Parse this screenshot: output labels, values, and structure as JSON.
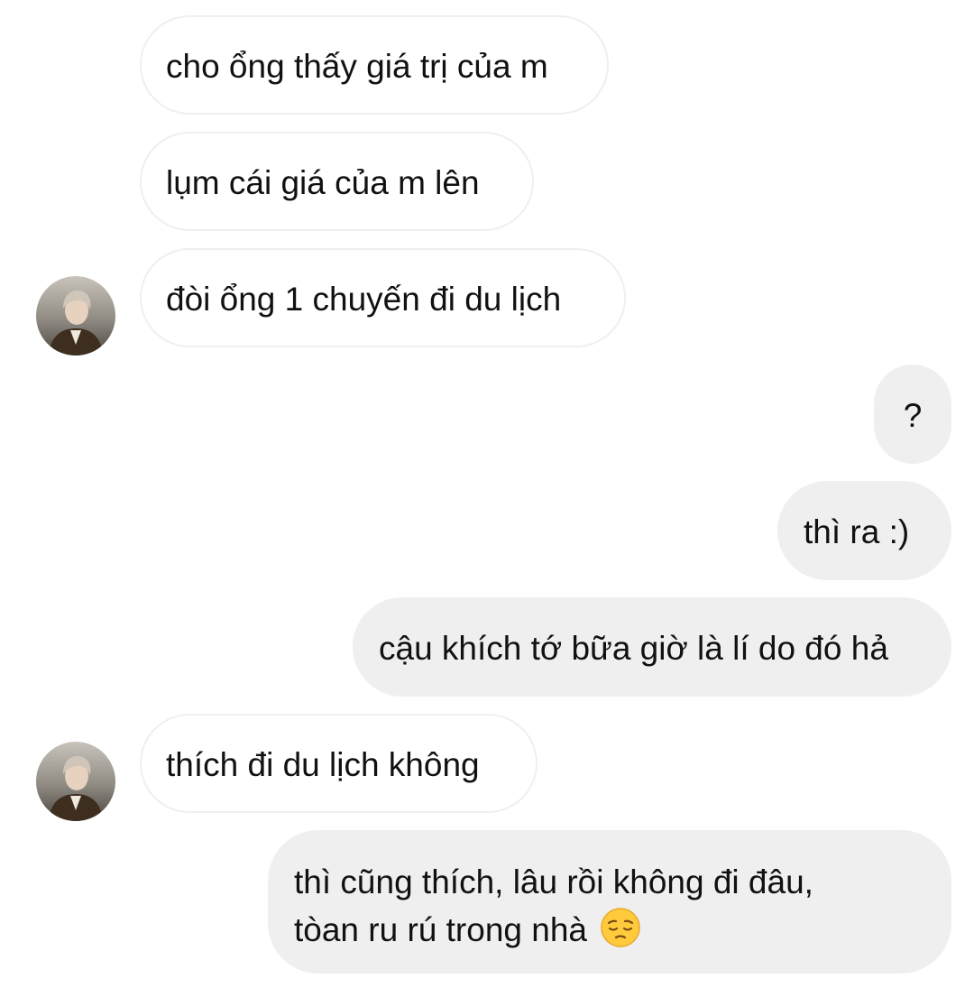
{
  "conversation": {
    "messages": [
      {
        "sender": "them",
        "text": "cho ổng thấy giá trị của m"
      },
      {
        "sender": "them",
        "text": "lụm cái giá của m lên"
      },
      {
        "sender": "them",
        "text": "đòi ổng 1 chuyến đi du lịch"
      },
      {
        "sender": "me",
        "text": "?"
      },
      {
        "sender": "me",
        "text": "thì ra :)"
      },
      {
        "sender": "me",
        "text": "cậu khích tớ bữa giờ là lí do đó hả"
      },
      {
        "sender": "them",
        "text": "thích đi du lịch không"
      },
      {
        "sender": "me",
        "text_line1": "thì cũng thích, lâu rồi không đi đâu,",
        "text_line2": "tòan ru rú trong nhà",
        "emoji": "pensive-face-icon"
      }
    ]
  },
  "colors": {
    "received_bubble_bg": "#ffffff",
    "received_bubble_border": "#efefef",
    "sent_bubble_bg": "#efefef",
    "text": "#111111"
  }
}
